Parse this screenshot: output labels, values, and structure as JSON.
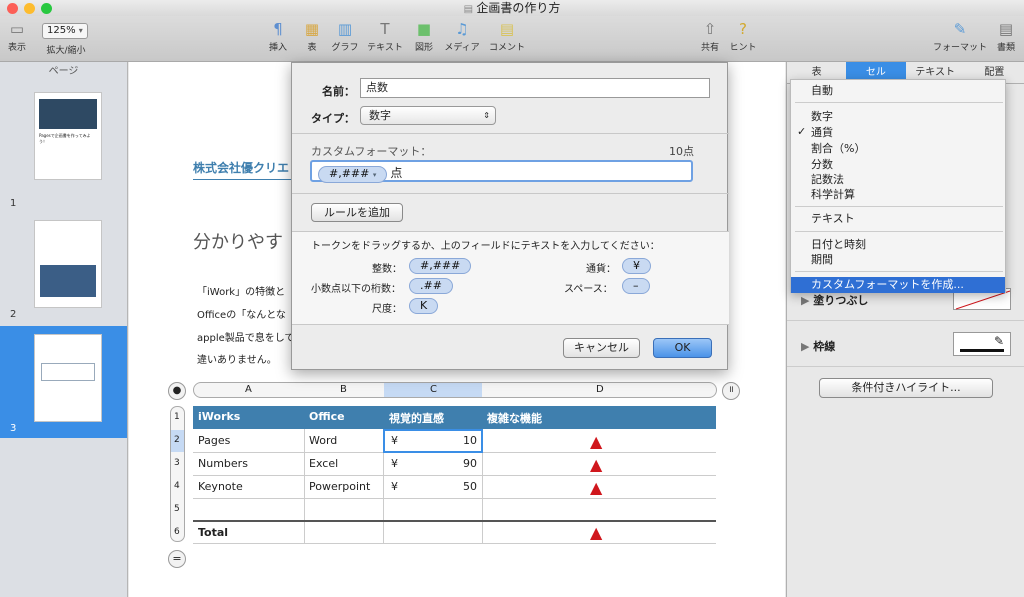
{
  "window": {
    "title": "企画書の作り方"
  },
  "toolbar": {
    "view_label": "表示",
    "zoom_value": "125%",
    "zoom_label": "拡大/縮小",
    "insert_label": "挿入",
    "table_label": "表",
    "chart_label": "グラフ",
    "text_label": "テキスト",
    "shape_label": "図形",
    "media_label": "メディア",
    "comment_label": "コメント",
    "share_label": "共有",
    "tips_label": "ヒント",
    "format_label": "フォーマット",
    "document_label": "書類"
  },
  "sidebar": {
    "header": "ページ",
    "pages": [
      "1",
      "2",
      "3"
    ],
    "thumb1_caption": "Pagesで企画書を作ってみよう！"
  },
  "document": {
    "company": "株式会社優クリエ",
    "heading": "分かりやす",
    "lines": [
      "「iWork」の特徴と",
      "Officeの「なんとな",
      "apple製品で息をして",
      "違いありません。"
    ]
  },
  "table": {
    "col_letters": [
      "A",
      "B",
      "C",
      "D"
    ],
    "row_numbers": [
      "1",
      "2",
      "3",
      "4",
      "5",
      "6"
    ],
    "header": [
      "iWorks",
      "Office",
      "視覚的直感",
      "複雑な機能"
    ],
    "rows": [
      [
        "Pages",
        "Word",
        "¥",
        "10"
      ],
      [
        "Numbers",
        "Excel",
        "¥",
        "90"
      ],
      [
        "Keynote",
        "Powerpoint",
        "¥",
        "50"
      ],
      [
        "",
        "",
        "",
        ""
      ],
      [
        "Total",
        "",
        "",
        ""
      ]
    ],
    "warning_icon": "warning-icon"
  },
  "dialog": {
    "name_label": "名前：",
    "name_value": "点数",
    "type_label": "タイプ：",
    "type_value": "数字",
    "custom_format_label": "カスタムフォーマット：",
    "preview": "10点",
    "format_token": "#,###",
    "format_suffix": "点",
    "add_rule": "ルールを追加",
    "instructions": "トークンをドラッグするか、上のフィールドにテキストを入力してください：",
    "tokens": [
      {
        "label": "整数：",
        "token": "#,###"
      },
      {
        "label": "小数点以下の桁数：",
        "token": ".##"
      },
      {
        "label": "尺度：",
        "token": "K"
      },
      {
        "label": "通貨：",
        "token": "¥"
      },
      {
        "label": "スペース：",
        "token": "–"
      }
    ],
    "cancel": "キャンセル",
    "ok": "OK"
  },
  "inspector": {
    "tabs": [
      "表",
      "セル",
      "テキスト",
      "配置"
    ],
    "fill_label": "塗りつぶし",
    "border_label": "枠線",
    "conditional_button": "条件付きハイライト..."
  },
  "menu": {
    "items": [
      "自動",
      "数字",
      "通貨",
      "割合（%）",
      "分数",
      "記数法",
      "科学計算",
      "テキスト",
      "日付と時刻",
      "期間",
      "カスタムフォーマットを作成..."
    ],
    "checked": "通貨"
  },
  "colors": {
    "accent": "#3a8ee6",
    "table_header": "#3f7fae",
    "warning": "#d0171d"
  }
}
